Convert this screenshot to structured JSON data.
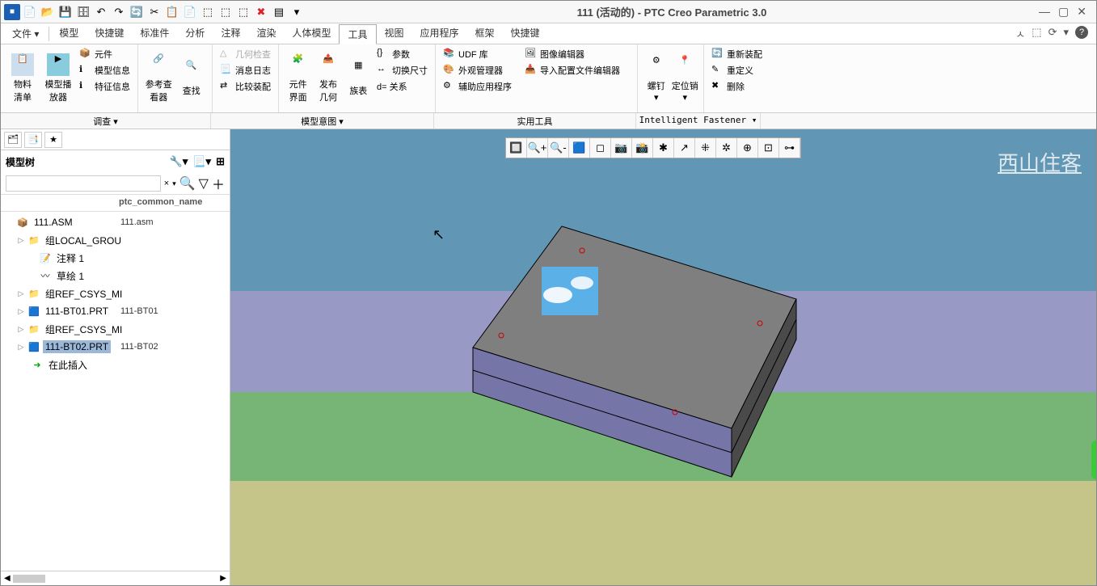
{
  "title": "111 (活动的) - PTC Creo Parametric 3.0",
  "menu": {
    "file": "文件",
    "tabs": [
      "模型",
      "快捷键",
      "标准件",
      "分析",
      "注释",
      "渲染",
      "人体模型",
      "工具",
      "视图",
      "应用程序",
      "框架",
      "快捷键"
    ],
    "active_tab": "工具"
  },
  "ribbon": {
    "bom": "物料\n清单",
    "model_play": "模型播\n放器",
    "component": "元件",
    "model_info": "模型信息",
    "feature_info": "特征信息",
    "ref_view": "参考查\n看器",
    "find": "查找",
    "geom_check": "几何检查",
    "msg_log": "消息日志",
    "compare_asm": "比较装配",
    "comp_ui": "元件\n界面",
    "publish_geom": "发布\n几何",
    "family": "族表",
    "params": "参数",
    "switch_size": "切换尺寸",
    "relations": "d= 关系",
    "udf": "UDF 库",
    "appearance_mgr": "外观管理器",
    "aux_app": "辅助应用程序",
    "img_editor": "图像编辑器",
    "import_config": "导入配置文件编辑器",
    "screw": "螺钉",
    "pin": "定位销",
    "reassemble": "重新装配",
    "redefine": "重定义",
    "delete": "删除"
  },
  "ribbon_footer": [
    "调查 ▾",
    "模型意图 ▾",
    "实用工具",
    "Intelligent Fastener ▾"
  ],
  "sidebar": {
    "title": "模型树",
    "col2": "ptc_common_name",
    "insert_here": "在此插入",
    "nodes": [
      {
        "name": "111.ASM",
        "col2": "111.asm",
        "indent": 0,
        "icon": "asm"
      },
      {
        "name": "组LOCAL_GROU",
        "indent": 1,
        "tri": true,
        "icon": "grp"
      },
      {
        "name": "注释 1",
        "indent": 2,
        "icon": "note"
      },
      {
        "name": "草绘 1",
        "indent": 2,
        "icon": "sketch"
      },
      {
        "name": "组REF_CSYS_MI",
        "indent": 1,
        "tri": true,
        "icon": "grp"
      },
      {
        "name": "111-BT01.PRT",
        "col2": "111-BT01",
        "indent": 1,
        "tri": true,
        "icon": "prt"
      },
      {
        "name": "组REF_CSYS_MI",
        "indent": 1,
        "tri": true,
        "icon": "grp"
      },
      {
        "name": "111-BT02.PRT",
        "col2": "111-BT02",
        "indent": 1,
        "tri": true,
        "icon": "prt",
        "sel": true
      }
    ]
  },
  "watermark": "西山住客"
}
